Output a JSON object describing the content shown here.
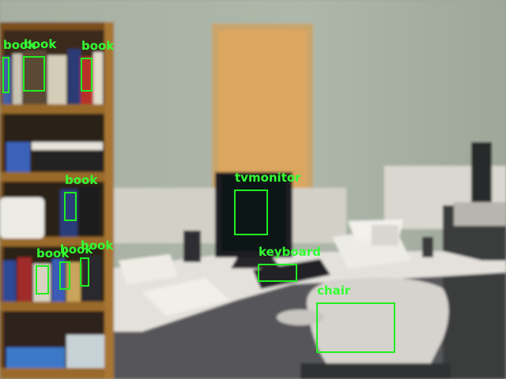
{
  "image": {
    "description_free": true
  },
  "colors": {
    "wall": "#a9b3a6",
    "door": "#d9a35c",
    "door_frame": "#c8a26a",
    "shelf_wood": "#8a5a22",
    "desk_top": "#e6e3de",
    "cubicle_panel": "#d8d6cf",
    "monitor": "#1b1d22",
    "chair": "#d7d4cf",
    "detection": "#22ee22"
  },
  "detections": [
    {
      "label": "book",
      "cls": "book"
    },
    {
      "label": "book",
      "cls": "book"
    },
    {
      "label": "book",
      "cls": "book"
    },
    {
      "label": "book",
      "cls": "book"
    },
    {
      "label": "book",
      "cls": "book"
    },
    {
      "label": "book",
      "cls": "book"
    },
    {
      "label": "book",
      "cls": "book"
    },
    {
      "label": "tvmonitor",
      "cls": "tvmonitor"
    },
    {
      "label": "keyboard",
      "cls": "keyboard"
    },
    {
      "label": "chair",
      "cls": "chair"
    }
  ]
}
